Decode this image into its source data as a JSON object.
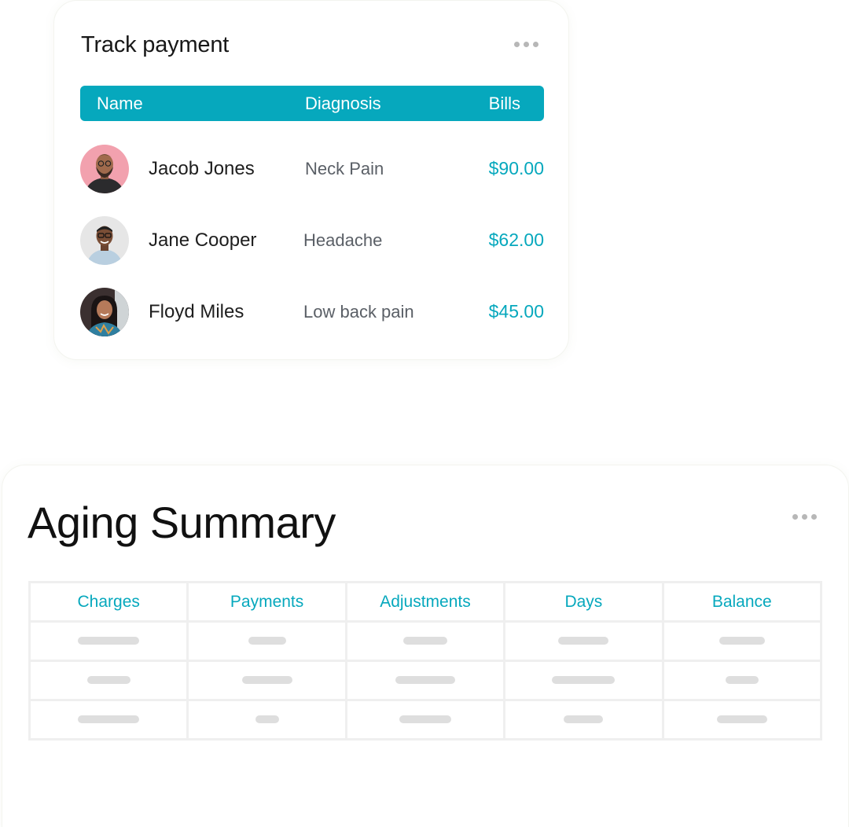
{
  "colors": {
    "accent": "#06a8bd",
    "text": "#1c1c1c",
    "muted": "#5a5f66",
    "placeholder": "#dedede"
  },
  "track_payment": {
    "title": "Track payment",
    "menu_icon": "more-horizontal-icon",
    "columns": {
      "name": "Name",
      "diagnosis": "Diagnosis",
      "bills": "Bills"
    },
    "rows": [
      {
        "name": "Jacob Jones",
        "diagnosis": "Neck Pain",
        "bill": "$90.00"
      },
      {
        "name": "Jane Cooper",
        "diagnosis": "Headache",
        "bill": "$62.00"
      },
      {
        "name": "Floyd Miles",
        "diagnosis": "Low back pain",
        "bill": "$45.00"
      }
    ]
  },
  "aging_summary": {
    "title": "Aging Summary",
    "menu_icon": "more-horizontal-icon",
    "columns": [
      "Charges",
      "Payments",
      "Adjustments",
      "Days",
      "Balance"
    ],
    "placeholder_rows": 3
  }
}
